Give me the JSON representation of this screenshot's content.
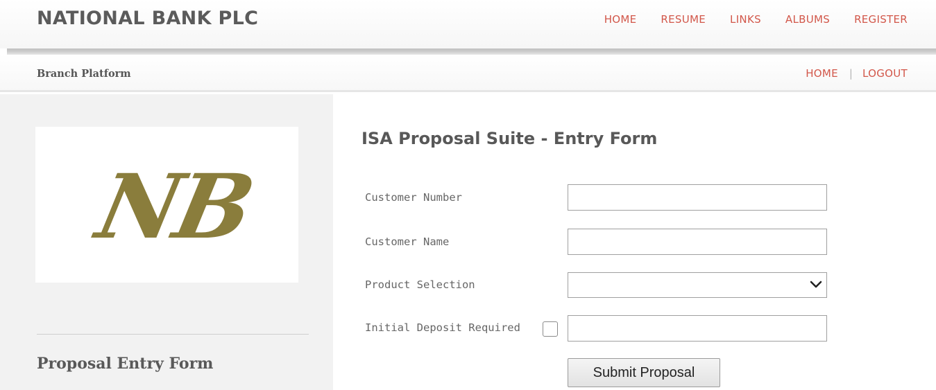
{
  "header": {
    "brand": "NATIONAL BANK PLC",
    "nav": [
      "HOME",
      "RESUME",
      "LINKS",
      "ALBUMS",
      "REGISTER"
    ]
  },
  "subheader": {
    "title": "Branch Platform",
    "nav": [
      "HOME",
      "LOGOUT"
    ],
    "separator": "|"
  },
  "sidebar": {
    "logo_text": "NB",
    "heading": "Proposal Entry Form"
  },
  "form": {
    "title": "ISA Proposal Suite - Entry Form",
    "fields": {
      "customer_number": {
        "label": "Customer Number",
        "value": ""
      },
      "customer_name": {
        "label": "Customer Name",
        "value": ""
      },
      "product_selection": {
        "label": "Product Selection",
        "value": ""
      },
      "initial_deposit": {
        "label": "Initial Deposit Required",
        "checked": false,
        "value": ""
      }
    },
    "submit_label": "Submit Proposal"
  },
  "colors": {
    "accent": "#d2574a",
    "logo": "#8a7d3c",
    "text": "#595959"
  },
  "icons": {
    "product_dropdown": "chevron-down-icon"
  }
}
